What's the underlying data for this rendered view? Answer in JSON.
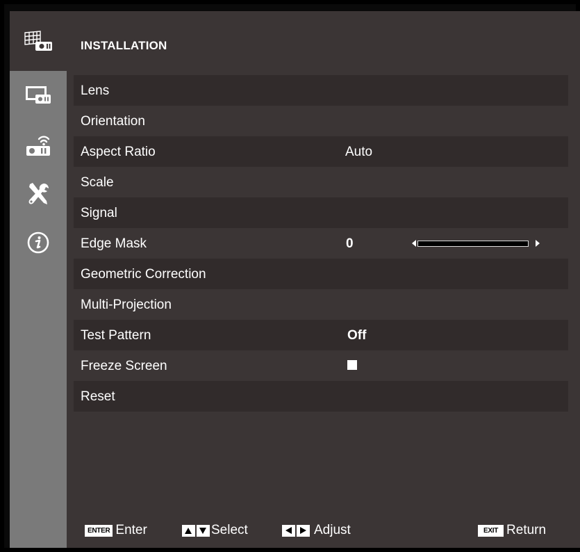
{
  "colors": {
    "sidebar": "#7a7a7a",
    "panel": "#3b3535",
    "row_stripe": "#312b2b",
    "text": "#ffffff"
  },
  "sidebar": {
    "tabs": [
      {
        "icon": "installation-icon",
        "active": true
      },
      {
        "icon": "display-icon",
        "active": false
      },
      {
        "icon": "network-projector-icon",
        "active": false
      },
      {
        "icon": "tools-icon",
        "active": false
      },
      {
        "icon": "info-icon",
        "active": false
      }
    ]
  },
  "main": {
    "title": "INSTALLATION",
    "items": [
      {
        "label": "Lens"
      },
      {
        "label": "Orientation"
      },
      {
        "label": "Aspect Ratio",
        "value": "Auto"
      },
      {
        "label": "Scale"
      },
      {
        "label": "Signal"
      },
      {
        "label": "Edge Mask",
        "value": "0",
        "slider_level": 0
      },
      {
        "label": "Geometric Correction"
      },
      {
        "label": "Multi-Projection"
      },
      {
        "label": "Test Pattern",
        "value": "Off"
      },
      {
        "label": "Freeze Screen",
        "checked": false
      },
      {
        "label": "Reset"
      }
    ]
  },
  "footer": {
    "enter_key": "ENTER",
    "enter_label": "Enter",
    "select_label": "Select",
    "adjust_label": "Adjust",
    "exit_key": "EXIT",
    "return_label": "Return"
  }
}
